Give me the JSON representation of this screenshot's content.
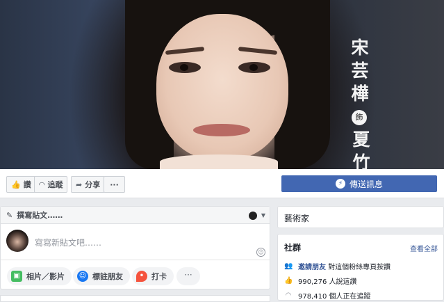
{
  "cover": {
    "title_vertical": "宋芸樺",
    "role_badge": "飾",
    "role_name": "夏竹"
  },
  "actions": {
    "like": "讚",
    "follow": "追蹤",
    "share": "分享",
    "more": "···",
    "send_message": "傳送訊息"
  },
  "composer": {
    "header": "撰寫貼文……",
    "placeholder": "寫寫新貼文吧……",
    "photo_video": "相片／影片",
    "tag_friends": "標註朋友",
    "check_in": "打卡",
    "more": "···"
  },
  "sidebar": {
    "category": "藝術家",
    "community_title": "社群",
    "see_all": "查看全部",
    "invite_link": "邀請朋友",
    "invite_text": "對這個粉絲專頁按讚",
    "likes_text": "990,276 人說這讚",
    "follows_text": "978,410 個人正在追蹤"
  },
  "icons": {
    "like": "thumbs-up-icon",
    "follow": "rss-icon",
    "share": "share-arrow-icon",
    "messenger": "messenger-icon",
    "pencil": "pencil-icon",
    "emoji": "smiley-icon",
    "photo": "photo-icon",
    "tag": "tag-friend-icon",
    "checkin": "location-pin-icon",
    "people": "people-icon",
    "thumb": "thumbs-up-icon",
    "rss": "rss-icon"
  },
  "colors": {
    "brand_blue": "#4267b2",
    "link_blue": "#385898",
    "background": "#e9ebee"
  }
}
